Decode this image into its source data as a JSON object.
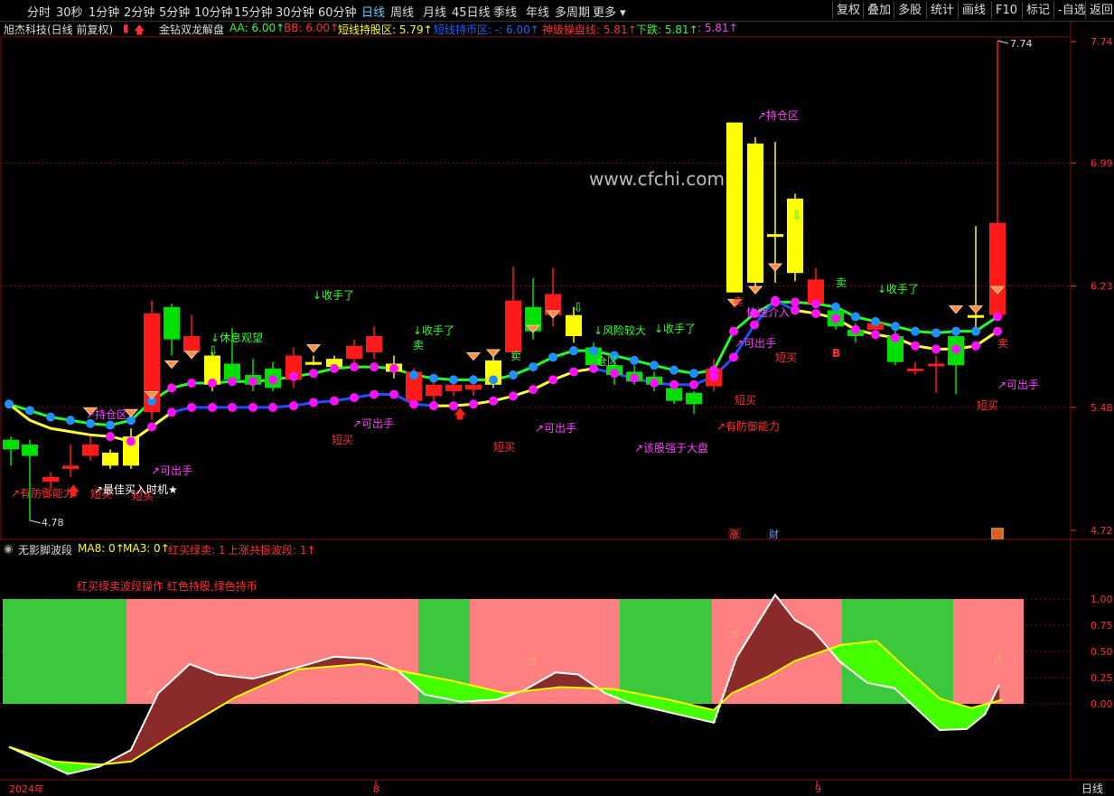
{
  "toolbar": {
    "periods": [
      "分时",
      "30秒",
      "1分钟",
      "2分钟",
      "5分钟",
      "10分钟",
      "15分钟",
      "30分钟",
      "60分钟",
      "日线",
      "周线",
      "月线",
      "45日线",
      "季线",
      "年线",
      "多周期",
      "更多"
    ],
    "active": "日线",
    "right": [
      "复权",
      "叠加",
      "多股",
      "统计",
      "画线",
      "F10",
      "标记",
      "-自选",
      "返回"
    ]
  },
  "main_header": {
    "stock": "旭杰科技(日线 前复权)",
    "indicator": "金钻双龙解盘",
    "aa": "AA: 6.00↑",
    "bb": "BB: 6.00↑",
    "hold_zone": "短线持股区: 5.79↑",
    "hold_coin": "短线持币区: -: 6.00↑",
    "operate": "神级操盘线: 5.81↑",
    "down": "下跌: 5.81↑",
    "extra": ": 5.81↑"
  },
  "sub_header": {
    "name": "无影脚波段",
    "ma8": "MA8: 0↑",
    "ma3": "MA3: 0↑",
    "red_buy": "红买绿卖: 1",
    "co_rise": "上涨共振波段: 1↑"
  },
  "sub_note": "红买绿卖波段操作 红色持股,绿色持币",
  "watermark": "www.cfchi.com",
  "price_axis": [
    "7.74",
    "6.99",
    "6.23",
    "5.48",
    "4.72"
  ],
  "sub_axis": [
    "1.00",
    "0.75",
    "0.50",
    "0.25",
    "0.00"
  ],
  "high_label": "7.74",
  "low_label": "4.78",
  "time_axis": [
    "2024年",
    "8",
    "9"
  ],
  "bottom_right": "日线",
  "markers": {
    "zhang": "涨",
    "cai": "财",
    "bang": "榜"
  },
  "annotations": [
    {
      "t": "↗有防御能力",
      "c": "#ff3030"
    },
    {
      "t": "短买",
      "c": "#ff3030"
    },
    {
      "t": "短买",
      "c": "#ff3030"
    },
    {
      "t": "↗最佳买入时机★",
      "c": "#ffffff"
    },
    {
      "t": "↗持仓区",
      "c": "#ff40ff"
    },
    {
      "t": "↗可出手",
      "c": "#ff40ff"
    },
    {
      "t": "↓休息观望",
      "c": "#30ff30"
    },
    {
      "t": "↓收手了",
      "c": "#30ff30"
    },
    {
      "t": "↗可出手",
      "c": "#ff40ff"
    },
    {
      "t": "短买",
      "c": "#ff3030"
    },
    {
      "t": "↓收手了",
      "c": "#30ff30"
    },
    {
      "t": "卖",
      "c": "#30ff30"
    },
    {
      "t": "短买",
      "c": "#ff3030"
    },
    {
      "t": "↗可出手",
      "c": "#ff40ff"
    },
    {
      "t": "卖",
      "c": "#30ff30"
    },
    {
      "t": "↓风险较大",
      "c": "#30ff30"
    },
    {
      "t": "仓区",
      "c": "#30ff30"
    },
    {
      "t": "↓收手了",
      "c": "#30ff30"
    },
    {
      "t": "↗该股强于大盘",
      "c": "#ff40ff"
    },
    {
      "t": "短买",
      "c": "#ff3030"
    },
    {
      "t": "↗有防御能力",
      "c": "#ff3030"
    },
    {
      "t": "↗持仓区",
      "c": "#ff40ff"
    },
    {
      "t": "↗可出手",
      "c": "#ff40ff"
    },
    {
      "t": "快速介入",
      "c": "#ff40ff"
    },
    {
      "t": "短买",
      "c": "#ff3030"
    },
    {
      "t": "卖",
      "c": "#ff3030"
    },
    {
      "t": "卖",
      "c": "#30ff30"
    },
    {
      "t": "↓收手了",
      "c": "#30ff30"
    },
    {
      "t": "B",
      "c": "#ff3030"
    },
    {
      "t": "↗可出手",
      "c": "#ff40ff"
    },
    {
      "t": "短买",
      "c": "#ff3030"
    },
    {
      "t": "卖",
      "c": "#ff3030"
    }
  ],
  "colors": {
    "up": "#ff1a1a",
    "down": "#00e000",
    "yellow": "#ffff00",
    "red_zone": "#ff8080",
    "green_zone": "#3cc83c"
  }
}
